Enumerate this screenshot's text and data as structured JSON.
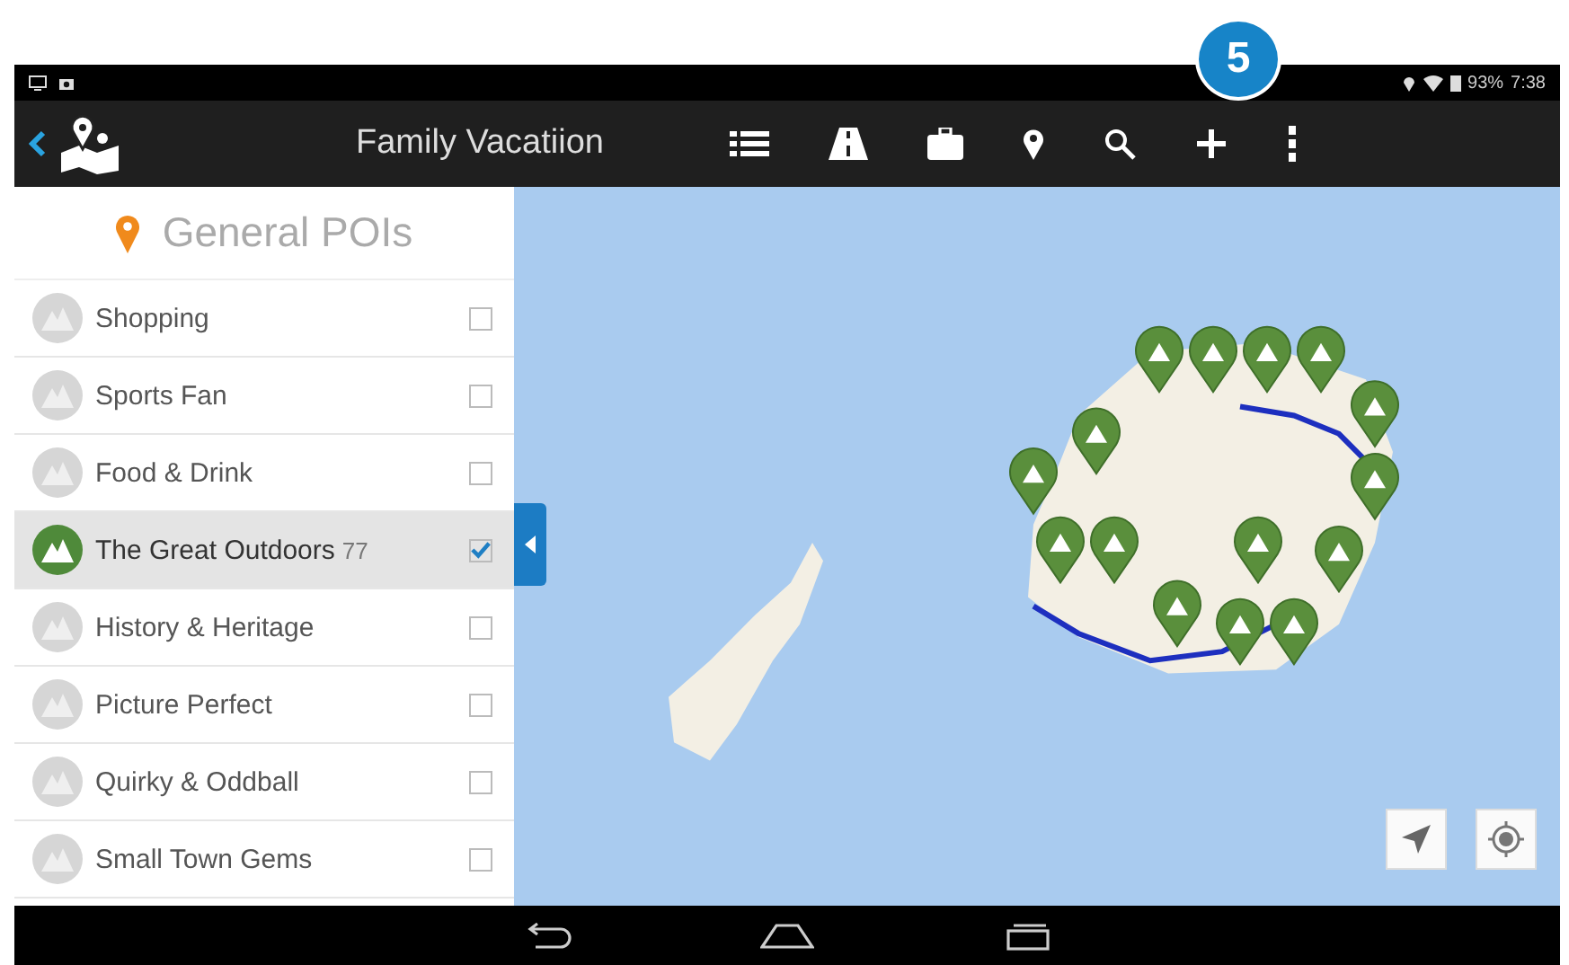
{
  "callout": "5",
  "status_bar": {
    "battery": "93%",
    "time": "7:38"
  },
  "toolbar": {
    "title": "Family Vacatiion"
  },
  "sidebar": {
    "title": "General POIs",
    "items": [
      {
        "label": "Shopping",
        "checked": false,
        "selected": false
      },
      {
        "label": "Sports Fan",
        "checked": false,
        "selected": false
      },
      {
        "label": "Food & Drink",
        "checked": false,
        "selected": false
      },
      {
        "label": "The Great Outdoors",
        "count": "77",
        "checked": true,
        "selected": true
      },
      {
        "label": "History & Heritage",
        "checked": false,
        "selected": false
      },
      {
        "label": "Picture Perfect",
        "checked": false,
        "selected": false
      },
      {
        "label": "Quirky & Oddball",
        "checked": false,
        "selected": false
      },
      {
        "label": "Small Town Gems",
        "checked": false,
        "selected": false
      }
    ]
  }
}
